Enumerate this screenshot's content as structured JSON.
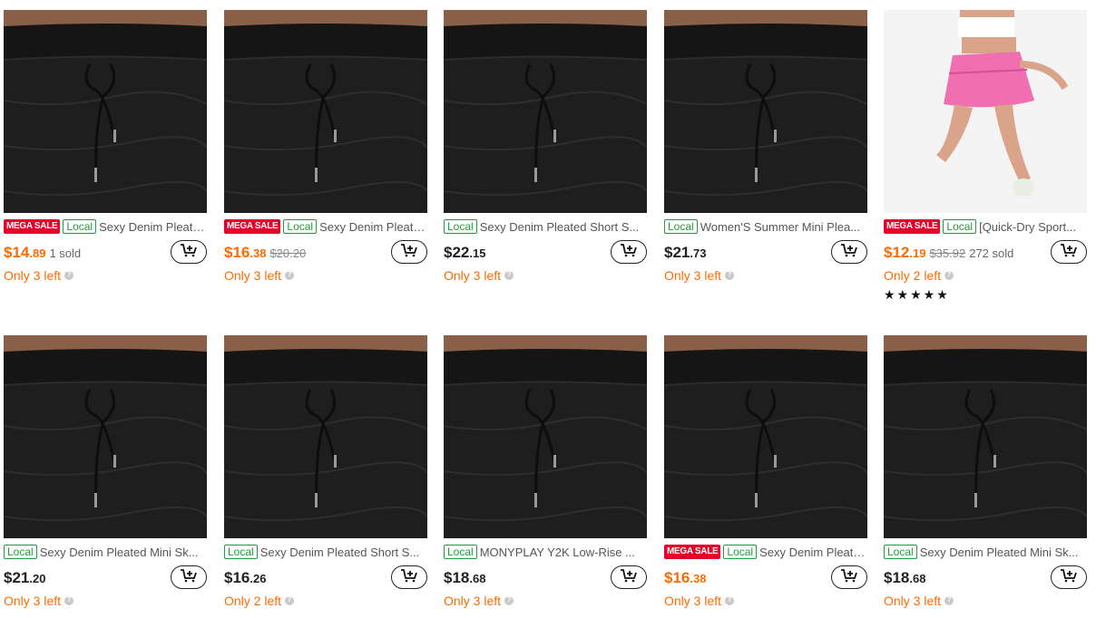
{
  "products": [
    {
      "mega": true,
      "local": "Local",
      "mega_label": "MEGA SALE",
      "title": "Sexy Denim Pleated Mini Skirt",
      "price_int": "$14",
      "price_dec": ".89",
      "sale": true,
      "orig": "",
      "sold": "1 sold",
      "stock": "Only 3 left",
      "stars": "",
      "img": "black"
    },
    {
      "mega": true,
      "local": "Local",
      "mega_label": "MEGA SALE",
      "title": "Sexy Denim Pleated Short Skirt",
      "price_int": "$16",
      "price_dec": ".38",
      "sale": true,
      "orig": "$20.20",
      "sold": "",
      "stock": "Only 3 left",
      "stars": "",
      "img": "black"
    },
    {
      "mega": false,
      "local": "Local",
      "mega_label": "",
      "title": "Sexy Denim Pleated Short S...",
      "price_int": "$22",
      "price_dec": ".15",
      "sale": false,
      "orig": "",
      "sold": "",
      "stock": "Only 3 left",
      "stars": "",
      "img": "black"
    },
    {
      "mega": false,
      "local": "Local",
      "mega_label": "",
      "title": "Women'S Summer Mini Plea...",
      "price_int": "$21",
      "price_dec": ".73",
      "sale": false,
      "orig": "",
      "sold": "",
      "stock": "Only 3 left",
      "stars": "",
      "img": "black"
    },
    {
      "mega": true,
      "local": "Local",
      "mega_label": "MEGA SALE",
      "title": "[Quick-Dry Sport...",
      "price_int": "$12",
      "price_dec": ".19",
      "sale": true,
      "orig": "$35.92",
      "sold": "272 sold",
      "stock": "Only 2 left",
      "stars": "★★★★★",
      "img": "pink"
    },
    {
      "mega": false,
      "local": "Local",
      "mega_label": "",
      "title": "Sexy Denim Pleated Mini Sk...",
      "price_int": "$21",
      "price_dec": ".20",
      "sale": false,
      "orig": "",
      "sold": "",
      "stock": "Only 3 left",
      "stars": "",
      "img": "black"
    },
    {
      "mega": false,
      "local": "Local",
      "mega_label": "",
      "title": "Sexy Denim Pleated Short S...",
      "price_int": "$16",
      "price_dec": ".26",
      "sale": false,
      "orig": "",
      "sold": "",
      "stock": "Only 2 left",
      "stars": "",
      "img": "black"
    },
    {
      "mega": false,
      "local": "Local",
      "mega_label": "",
      "title": "MONYPLAY Y2K Low-Rise ...",
      "price_int": "$18",
      "price_dec": ".68",
      "sale": false,
      "orig": "",
      "sold": "",
      "stock": "Only 3 left",
      "stars": "",
      "img": "black"
    },
    {
      "mega": true,
      "local": "Local",
      "mega_label": "MEGA SALE",
      "title": "Sexy Denim Pleated Mini Skirt",
      "price_int": "$16",
      "price_dec": ".38",
      "sale": true,
      "orig": "",
      "sold": "",
      "stock": "Only 3 left",
      "stars": "",
      "img": "black"
    },
    {
      "mega": false,
      "local": "Local",
      "mega_label": "",
      "title": "Sexy Denim Pleated Mini Sk...",
      "price_int": "$18",
      "price_dec": ".68",
      "sale": false,
      "orig": "",
      "sold": "",
      "stock": "Only 3 left",
      "stars": "",
      "img": "black"
    }
  ],
  "icons": {
    "cart": "add-to-cart-icon",
    "info": "info-icon"
  },
  "colors": {
    "sale_price": "#ff6a00",
    "mega_badge": "#e4002b",
    "local_badge": "#1f9d3c"
  }
}
